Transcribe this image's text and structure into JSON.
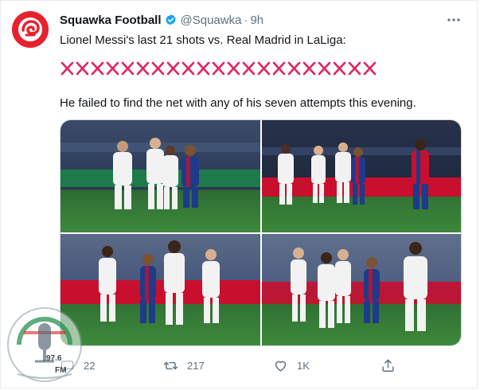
{
  "tweet": {
    "author_name": "Squawka Football",
    "handle": "@Squawka",
    "separator": "·",
    "time": "9h",
    "text_line1": "Lionel Messi's last 21 shots vs. Real Madrid in LaLiga:",
    "cross_count": 21,
    "text_line3": "He failed to find the net with any of his seven attempts this evening."
  },
  "actions": {
    "reply_count": "22",
    "retweet_count": "217",
    "like_count": "1K"
  },
  "watermark": {
    "frequency": "97.6",
    "band": "FM"
  },
  "colors": {
    "avatar": "#e8212f",
    "verified": "#1da1f2",
    "cross": "#e0245e",
    "muted_text": "#5b7083"
  },
  "icons": {
    "more": "more-icon",
    "reply": "reply-icon",
    "retweet": "retweet-icon",
    "like": "heart-icon",
    "share": "share-icon"
  }
}
